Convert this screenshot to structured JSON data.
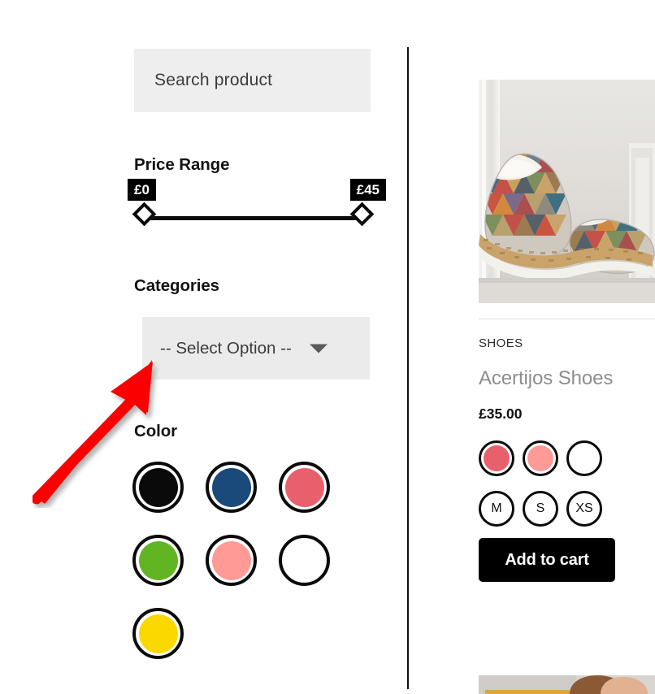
{
  "sidebar": {
    "search": {
      "placeholder": "Search product",
      "value": ""
    },
    "price_range": {
      "heading": "Price Range",
      "min_label": "£0",
      "max_label": "£45",
      "min_value": 0,
      "max_value": 45,
      "currency": "£"
    },
    "categories": {
      "heading": "Categories",
      "selected_label": "-- Select Option --",
      "chevron_icon": "chevron-down-icon"
    },
    "color": {
      "heading": "Color",
      "swatches": [
        {
          "name": "black",
          "hex": "#0a0a0a"
        },
        {
          "name": "navy",
          "hex": "#1a4a79"
        },
        {
          "name": "coral",
          "hex": "#e8606b"
        },
        {
          "name": "green",
          "hex": "#62b522"
        },
        {
          "name": "pink",
          "hex": "#ff9a96"
        },
        {
          "name": "white",
          "hex": "#ffffff"
        },
        {
          "name": "yellow",
          "hex": "#fbd900"
        }
      ]
    }
  },
  "annotation": {
    "arrow_color": "#fb0000",
    "points_at": "categories-select"
  },
  "product": {
    "category": "SHOES",
    "title": "Acertijos Shoes",
    "price": "£35.00",
    "image_alt": "patterned espadrille slip-on shoes",
    "colors": [
      {
        "name": "coral",
        "hex": "#e8606b"
      },
      {
        "name": "pink",
        "hex": "#ff9a96"
      },
      {
        "name": "white",
        "hex": "#ffffff"
      }
    ],
    "sizes": [
      "M",
      "S",
      "XS"
    ],
    "add_to_cart_label": "Add to cart"
  }
}
